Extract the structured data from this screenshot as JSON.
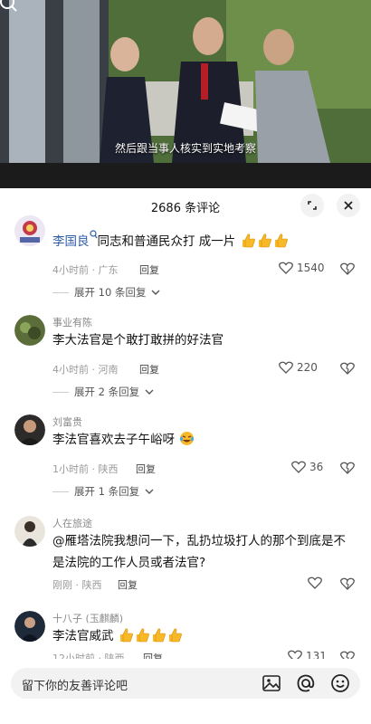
{
  "video": {
    "caption": "然后跟当事人核实到实地考察",
    "icons": [
      "search-icon"
    ]
  },
  "sheet": {
    "title": "2686 条评论",
    "icons": [
      "minimize-icon",
      "close-icon"
    ]
  },
  "comments": [
    {
      "username": "",
      "mention": "李国良",
      "text": "同志和普通民众打 成一片",
      "emojis": [
        "thumbs-up",
        "thumbs-up",
        "thumbs-up"
      ],
      "meta": "4小时前 · 广东",
      "reply": "回复",
      "likes": "1540",
      "expand": "展开 10 条回复"
    },
    {
      "username": "事业有陈",
      "mention": "",
      "text": "李大法官是个敢打敢拼的好法官",
      "emojis": [],
      "meta": "4小时前 · 河南",
      "reply": "回复",
      "likes": "220",
      "expand": "展开 2 条回复"
    },
    {
      "username": "刘富贵",
      "mention": "",
      "text": "李法官喜欢去子午峪呀",
      "emojis": [
        "laughing-crying"
      ],
      "meta": "1小时前 · 陕西",
      "reply": "回复",
      "likes": "36",
      "expand": "展开 1 条回复"
    },
    {
      "username": "人在旅途",
      "mention": "",
      "text": "@雁塔法院我想问一下，乱扔垃圾打人的那个到底是不是法院的工作人员或者法官?",
      "emojis": [],
      "meta": "刚刚 · 陕西",
      "reply": "回复",
      "likes": "",
      "expand": ""
    },
    {
      "username": "十八子 (玉麒麟)",
      "mention": "",
      "text": "李法官威武",
      "emojis": [
        "thumbs-up",
        "thumbs-up",
        "thumbs-up",
        "thumbs-up"
      ],
      "meta": "12小时前 · 陕西",
      "reply": "回复",
      "likes": "131",
      "expand": ""
    }
  ],
  "input": {
    "placeholder": "留下你的友善评论吧",
    "icons": [
      "image-icon",
      "at-icon",
      "emoji-icon"
    ]
  },
  "colors": {
    "mention": "#2d5da8",
    "meta": "#9a9a9a",
    "emoji_yellow": "#f7b928",
    "background": "#ffffff"
  }
}
